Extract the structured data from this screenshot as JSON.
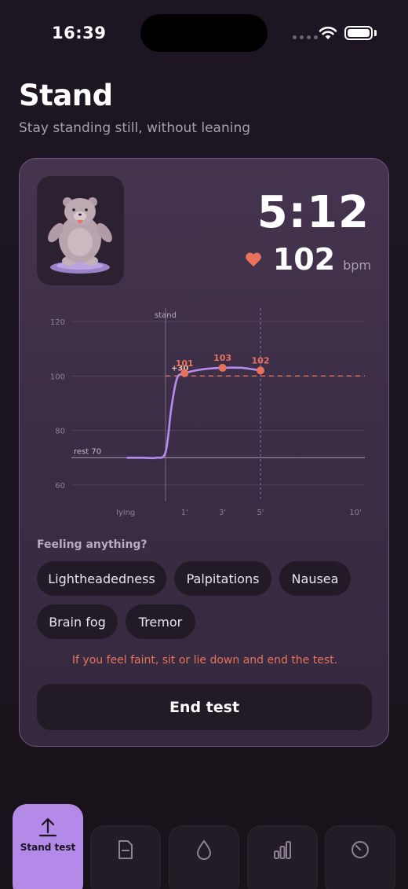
{
  "status_bar": {
    "time": "16:39"
  },
  "header": {
    "title": "Stand",
    "subtitle": "Stay standing still, without leaning"
  },
  "timer": {
    "elapsed": "5:12"
  },
  "heart_rate": {
    "value": "102",
    "unit": "bpm"
  },
  "chart_data": {
    "type": "line",
    "y_ticks": [
      "120",
      "100",
      "80",
      "60"
    ],
    "ylim": [
      60,
      120
    ],
    "x_tick_labels": [
      "lying",
      "1'",
      "3'",
      "5'",
      "10'"
    ],
    "stand_marker_label": "stand",
    "rest_label": "rest 70",
    "rest_value": 70,
    "threshold_label": "+30",
    "threshold_value": 100,
    "series": [
      {
        "x": [
          -2,
          -1.2,
          -0.5,
          0,
          0.3,
          0.6,
          1,
          2,
          3,
          4,
          5
        ],
        "values": [
          70,
          70,
          70,
          72,
          88,
          99,
          101,
          102.5,
          103,
          103,
          102
        ]
      }
    ],
    "points": [
      {
        "x": 1,
        "y": 101,
        "label": "101"
      },
      {
        "x": 3,
        "y": 103,
        "label": "103"
      },
      {
        "x": 5,
        "y": 102,
        "label": "102"
      }
    ],
    "colors": {
      "line": "#b78cf0",
      "accent": "#e8735a",
      "grid": "#5a4a63",
      "axis_text": "#8e8295"
    }
  },
  "symptoms": {
    "label": "Feeling anything?",
    "chips": [
      "Lightheadedness",
      "Palpitations",
      "Nausea",
      "Brain fog",
      "Tremor"
    ]
  },
  "warning": "If you feel faint, sit or lie down and end the test.",
  "end_button": "End test",
  "nav": {
    "tabs": [
      {
        "label": "Stand test",
        "icon": "upload-icon",
        "active": true
      },
      {
        "label": "",
        "icon": "document-icon",
        "active": false
      },
      {
        "label": "",
        "icon": "drop-icon",
        "active": false
      },
      {
        "label": "",
        "icon": "bar-chart-icon",
        "active": false
      },
      {
        "label": "",
        "icon": "gauge-icon",
        "active": false
      }
    ]
  },
  "theme": {
    "accent": "#b48ae8",
    "warning": "#e8735a",
    "background": "#1e1523"
  }
}
